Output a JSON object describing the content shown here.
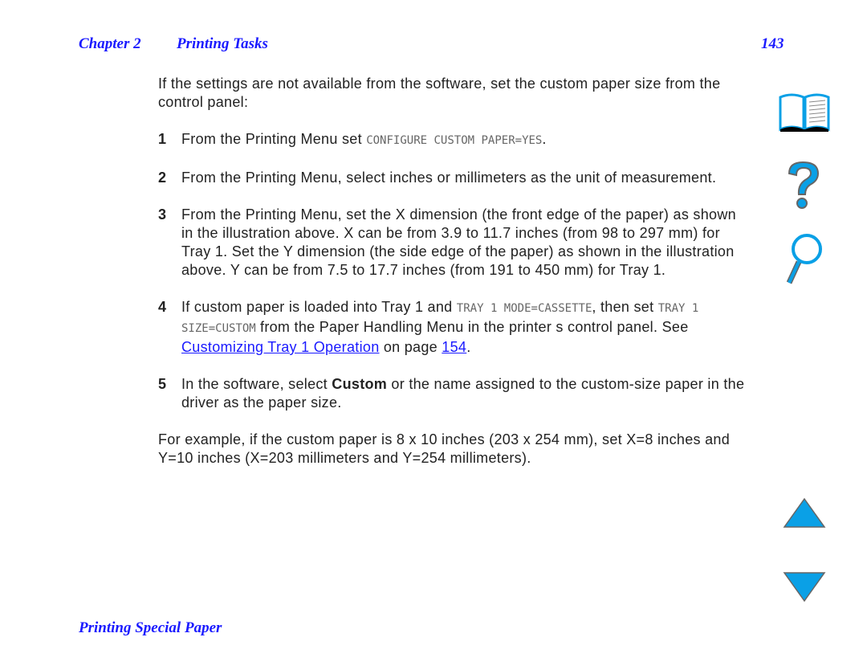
{
  "header": {
    "chapter": "Chapter 2",
    "title": "Printing Tasks",
    "page": "143"
  },
  "intro": "If the settings are not available from the software, set the custom paper size from the control panel:",
  "steps": [
    {
      "n": "1",
      "a": "From the Printing Menu set ",
      "code": "CONFIGURE CUSTOM PAPER=YES",
      "b": "."
    },
    {
      "n": "2",
      "text": "From the Printing Menu, select inches or millimeters as the unit of measurement."
    },
    {
      "n": "3",
      "text": "From the Printing Menu, set the X dimension (the front edge of the paper) as shown in the illustration above. X can be from 3.9 to 11.7 inches (from 98 to 297 mm) for Tray 1. Set the Y dimension (the side edge of the paper) as shown in the illustration above. Y can be from 7.5 to 17.7 inches (from 191 to 450 mm) for Tray 1."
    },
    {
      "n": "4",
      "a": "If custom paper is loaded into Tray 1 and ",
      "code1": "TRAY 1 MODE=CASSETTE",
      "b": ", then set ",
      "code2": "TRAY 1 SIZE=CUSTOM",
      "c": " from the Paper Handling Menu in the printer s control panel. See ",
      "link": "Customizing Tray 1 Operation",
      "d": " on page ",
      "page_link": "154",
      "e": "."
    },
    {
      "n": "5",
      "a": "In the software, select ",
      "bold": "Custom",
      "b": " or the name assigned to the custom-size paper in the driver as the paper size."
    }
  ],
  "example": "For example, if the custom paper is 8 x 10 inches (203 x 254 mm), set X=8 inches and Y=10 inches (X=203 millimeters and Y=254 millimeters).",
  "footer": "Printing Special Paper",
  "icons": [
    "book-icon",
    "question-icon",
    "magnifier-icon",
    "previous-page-icon",
    "next-page-icon"
  ],
  "colors": {
    "heading": "#1a1aff",
    "icon": "#0aa0e6"
  }
}
